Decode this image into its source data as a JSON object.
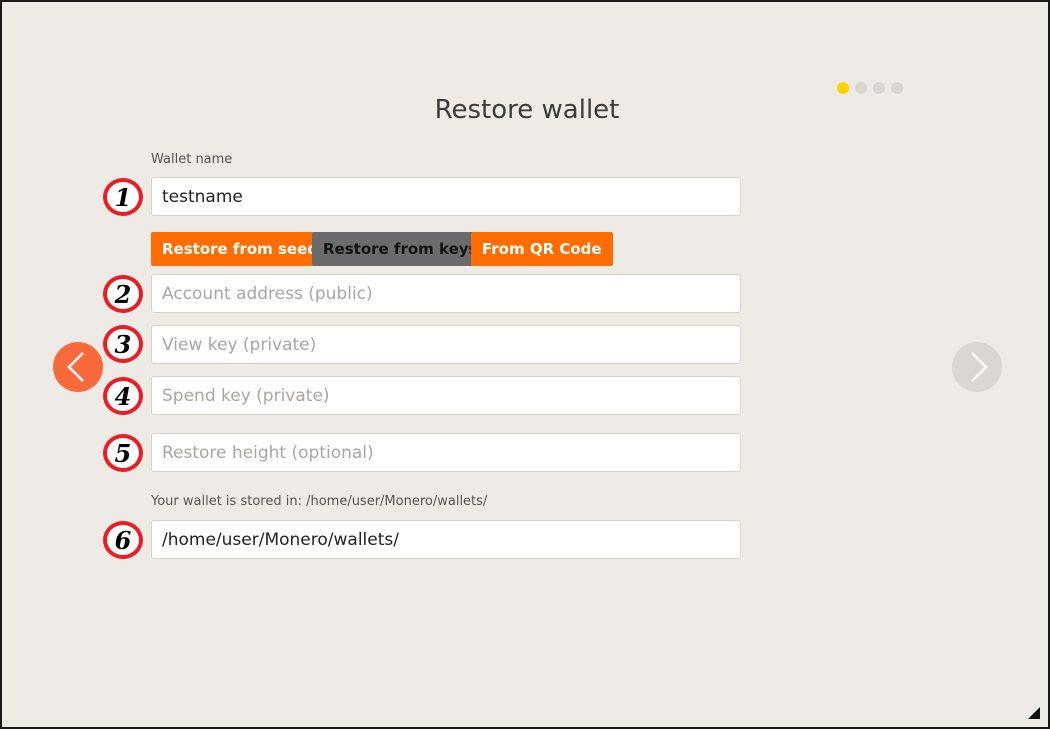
{
  "page": {
    "title": "Restore wallet"
  },
  "progress": {
    "steps": 4,
    "current_step": 1,
    "active_color": "#ffd400"
  },
  "wallet_name": {
    "label": "Wallet name",
    "value": "testname"
  },
  "restore_options": {
    "seed_label": "Restore from seed",
    "keys_label": "Restore from keys",
    "qr_label": "From QR Code",
    "selected": "Restore from keys",
    "accent_color": "#ff6c00"
  },
  "fields": {
    "account_address_placeholder": "Account address (public)",
    "view_key_placeholder": "View key (private)",
    "spend_key_placeholder": "Spend key (private)",
    "restore_height_placeholder": "Restore height (optional)"
  },
  "storage": {
    "label": "Your wallet is stored in: /home/user/Monero/wallets/",
    "value": "/home/user/Monero/wallets/"
  },
  "annotations": [
    "1",
    "2",
    "3",
    "4",
    "5",
    "6"
  ],
  "nav": {
    "back_icon": "chevron-left-icon",
    "next_icon": "chevron-right-icon"
  }
}
